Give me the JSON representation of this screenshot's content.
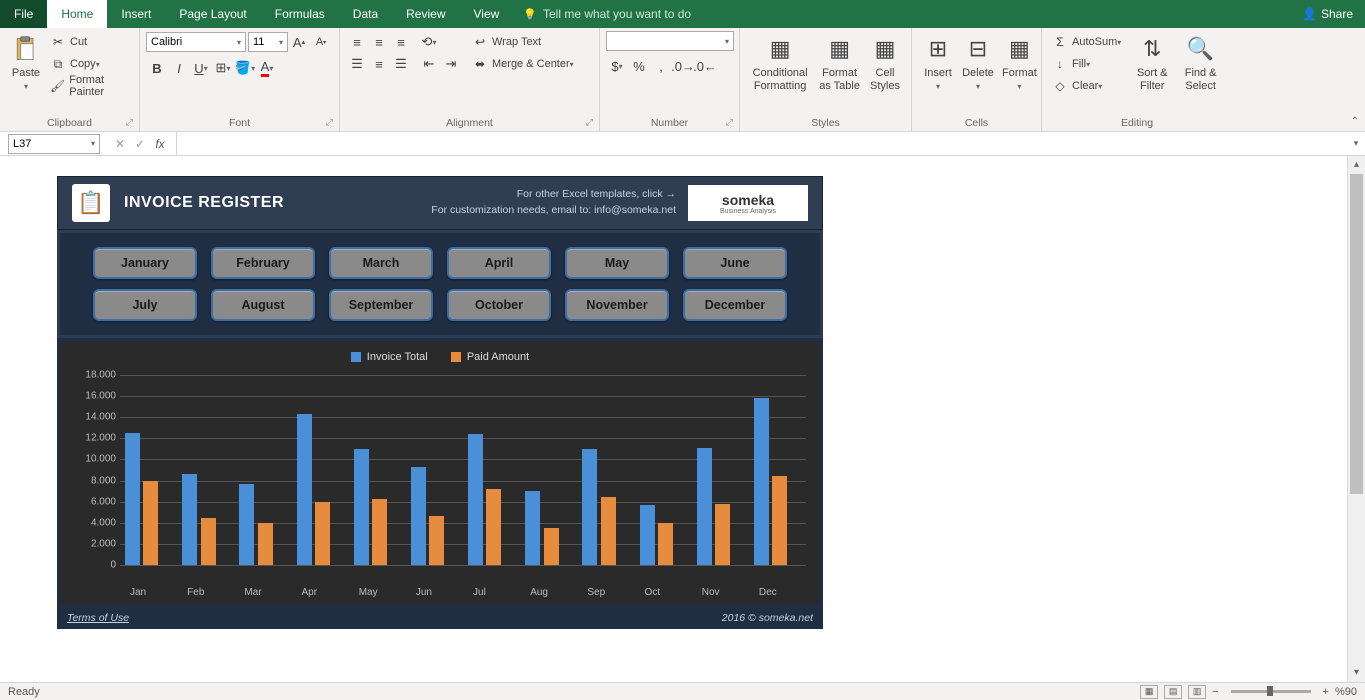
{
  "tabs": {
    "file": "File",
    "home": "Home",
    "insert": "Insert",
    "pagelayout": "Page Layout",
    "formulas": "Formulas",
    "data": "Data",
    "review": "Review",
    "view": "View",
    "tellme": "Tell me what you want to do"
  },
  "share": "Share",
  "ribbon": {
    "clipboard": {
      "label": "Clipboard",
      "paste": "Paste",
      "cut": "Cut",
      "copy": "Copy",
      "formatpainter": "Format Painter"
    },
    "font": {
      "label": "Font",
      "name": "Calibri",
      "size": "11"
    },
    "alignment": {
      "label": "Alignment",
      "wrap": "Wrap Text",
      "merge": "Merge & Center"
    },
    "number": {
      "label": "Number",
      "format": ""
    },
    "styles": {
      "label": "Styles",
      "conditional": "Conditional\nFormatting",
      "formatastable": "Format as\nTable",
      "cellstyles": "Cell\nStyles"
    },
    "cells": {
      "label": "Cells",
      "insert": "Insert",
      "delete": "Delete",
      "format": "Format"
    },
    "editing": {
      "label": "Editing",
      "autosum": "AutoSum",
      "fill": "Fill",
      "clear": "Clear",
      "sortfilter": "Sort &\nFilter",
      "findselect": "Find &\nSelect"
    }
  },
  "namebox": "L37",
  "dashboard": {
    "title": "INVOICE REGISTER",
    "link1": "For other Excel templates, click →",
    "link2": "For customization needs, email to: info@someka.net",
    "brand": "someka",
    "brandsub": "Business Analysis",
    "months": [
      "January",
      "February",
      "March",
      "April",
      "May",
      "June",
      "July",
      "August",
      "September",
      "October",
      "November",
      "December"
    ],
    "terms": "Terms of Use",
    "copyright": "2016 © someka.net"
  },
  "chart_data": {
    "type": "bar",
    "title": "",
    "categories": [
      "Jan",
      "Feb",
      "Mar",
      "Apr",
      "May",
      "Jun",
      "Jul",
      "Aug",
      "Sep",
      "Oct",
      "Nov",
      "Dec"
    ],
    "series": [
      {
        "name": "Invoice Total",
        "color": "#4a90d9",
        "values": [
          12500,
          8600,
          7700,
          14300,
          11000,
          9300,
          12400,
          7000,
          11000,
          5700,
          11100,
          15800
        ]
      },
      {
        "name": "Paid Amount",
        "color": "#e78b3e",
        "values": [
          8000,
          4500,
          4000,
          6000,
          6300,
          4600,
          7200,
          3500,
          6400,
          4000,
          5800,
          8400
        ]
      }
    ],
    "ylim": [
      0,
      18000
    ],
    "yticks": [
      0,
      2000,
      4000,
      6000,
      8000,
      10000,
      12000,
      14000,
      16000,
      18000
    ],
    "yticklabels": [
      "0",
      "2.000",
      "4.000",
      "6.000",
      "8.000",
      "10.000",
      "12.000",
      "14.000",
      "16.000",
      "18.000"
    ]
  },
  "status": {
    "ready": "Ready",
    "zoom": "%90"
  }
}
